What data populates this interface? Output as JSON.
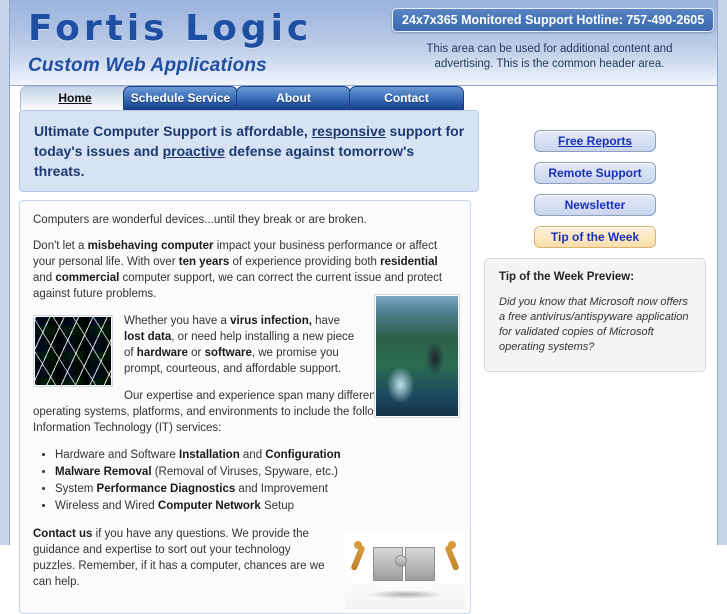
{
  "site": {
    "logo_title": "Fortis Logic",
    "logo_tagline": "Custom Web Applications"
  },
  "header": {
    "hotline_badge": "24x7x365 Monitored Support Hotline: 757-490-2605",
    "blurb": "This area can be used for additional content and advertising. This is the common header area."
  },
  "nav": {
    "tabs": [
      {
        "label": "Home",
        "active": true
      },
      {
        "label": "Schedule Service",
        "active": false
      },
      {
        "label": "About",
        "active": false
      },
      {
        "label": "Contact",
        "active": false
      }
    ]
  },
  "headline": {
    "part1": "Ultimate Computer Support is affordable, ",
    "underline1": "responsive",
    "part2": " support for today's issues and ",
    "underline2": "proactive",
    "part3": " defense against tomorrow's threats."
  },
  "article": {
    "intro": "Computers are wonderful devices...until they break or are broken.",
    "p2": {
      "a": "Don't let a ",
      "b1": "misbehaving computer",
      "c": " impact your business performance or affect your personal life. With over ",
      "b2": "ten years",
      "d": " of experience providing both ",
      "b3": "residential",
      "e": " and ",
      "b4": "commercial",
      "f": " computer support, we can correct the current issue and protect against future problems."
    },
    "p3": {
      "a": "Whether you have a ",
      "b1": "virus infection,",
      "c": " have ",
      "b2": "lost data",
      "d": ", or need help installing a new piece of ",
      "b3": "hardware",
      "e": " or ",
      "b4": "software",
      "f": ", we promise you prompt, courteous, and affordable support."
    },
    "p4": "Our expertise and experience span many different types of operating systems, platforms, and environments to include the following Information Technology (IT) services:",
    "services": [
      {
        "pre": "Hardware and Software ",
        "b1": "Installation",
        "mid": " and ",
        "b2": "Configuration",
        "post": ""
      },
      {
        "pre": "",
        "b1": "Malware Removal",
        "mid": " (Removal of Viruses, Spyware, etc.)",
        "b2": "",
        "post": ""
      },
      {
        "pre": "System ",
        "b1": "Performance Diagnostics",
        "mid": " and Improvement",
        "b2": "",
        "post": ""
      },
      {
        "pre": "Wireless and Wired ",
        "b1": "Computer Network",
        "mid": " Setup",
        "b2": "",
        "post": ""
      }
    ],
    "p5": {
      "b1": "Contact us",
      "rest": " if you have any questions. We provide the guidance and expertise to sort out your technology puzzles. Remember, if it has a computer, chances are we can help."
    },
    "images": {
      "code_image": "binary-code-network-image",
      "cables_image": "network-cabling-photo",
      "puzzle_image": "puzzle-pieces-teamwork-image"
    }
  },
  "sidebar": {
    "buttons": [
      {
        "label": "Free Reports",
        "style": "link"
      },
      {
        "label": "Remote Support",
        "style": "normal"
      },
      {
        "label": "Newsletter",
        "style": "normal"
      },
      {
        "label": "Tip of the Week",
        "style": "tip"
      }
    ],
    "tip_box": {
      "title": "Tip of the Week Preview:",
      "text": "Did you know that Microsoft now offers a free antivirus/antispyware application for validated copies of Microsoft operating systems?"
    }
  },
  "colors": {
    "brand_blue": "#1f4fa3",
    "header_gradient_top": "#9cb4dc",
    "tab_active_bg": "#dde5f2",
    "tab_inactive_bg": "#24509c",
    "headline_bg": "#d7e2f3",
    "link_blue": "#1a2fbe",
    "tip_btn_bg": "#fbe7c0",
    "gutter_blue": "#c6d4ec"
  }
}
